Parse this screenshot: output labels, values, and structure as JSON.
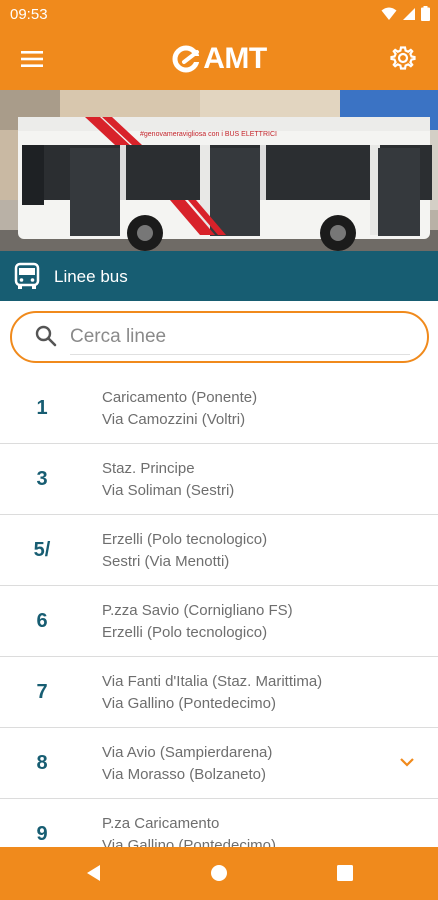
{
  "status_bar": {
    "time": "09:53",
    "icons": [
      "wifi-icon",
      "signal-icon",
      "battery-icon"
    ]
  },
  "app_bar": {
    "menu_icon": "menu-icon",
    "logo_text": "AMT",
    "settings_icon": "gear-icon",
    "background_color": "#f08a1c"
  },
  "hero": {
    "bus_banner_text": "#genovameravigliosa con i BUS ELETTRICI"
  },
  "section": {
    "icon": "bus-icon",
    "title": "Linee bus",
    "background_color": "#175d72"
  },
  "search": {
    "placeholder": "Cerca linee",
    "value": ""
  },
  "lines": [
    {
      "number": "1",
      "from": "Caricamento (Ponente)",
      "to": "Via Camozzini (Voltri)"
    },
    {
      "number": "3",
      "from": "Staz. Principe",
      "to": "Via Soliman (Sestri)"
    },
    {
      "number": "5/",
      "from": "Erzelli (Polo tecnologico)",
      "to": "Sestri (Via Menotti)"
    },
    {
      "number": "6",
      "from": "P.zza Savio (Cornigliano FS)",
      "to": "Erzelli (Polo tecnologico)"
    },
    {
      "number": "7",
      "from": "Via Fanti d'Italia (Staz. Marittima)",
      "to": "Via Gallino (Pontedecimo)"
    },
    {
      "number": "8",
      "from": "Via Avio (Sampierdarena)",
      "to": "Via Morasso (Bolzaneto)",
      "expandable": true
    },
    {
      "number": "9",
      "from": "P.za Caricamento",
      "to": "Via Gallino (Pontedecimo)"
    }
  ],
  "nav_bar": {
    "buttons": [
      "back-icon",
      "home-icon",
      "recents-icon"
    ]
  }
}
